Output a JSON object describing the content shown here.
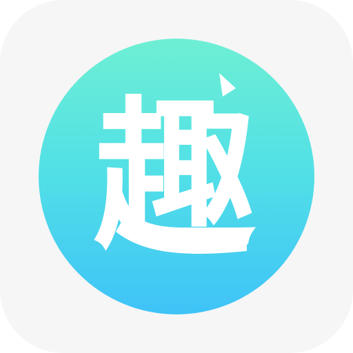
{
  "icon": {
    "name": "趣",
    "character": "趣",
    "glyph_color": "#ffffff",
    "background_color": "#f6f6f6",
    "gradient_top": "#6eefd4",
    "gradient_bottom": "#3fc3f8"
  }
}
